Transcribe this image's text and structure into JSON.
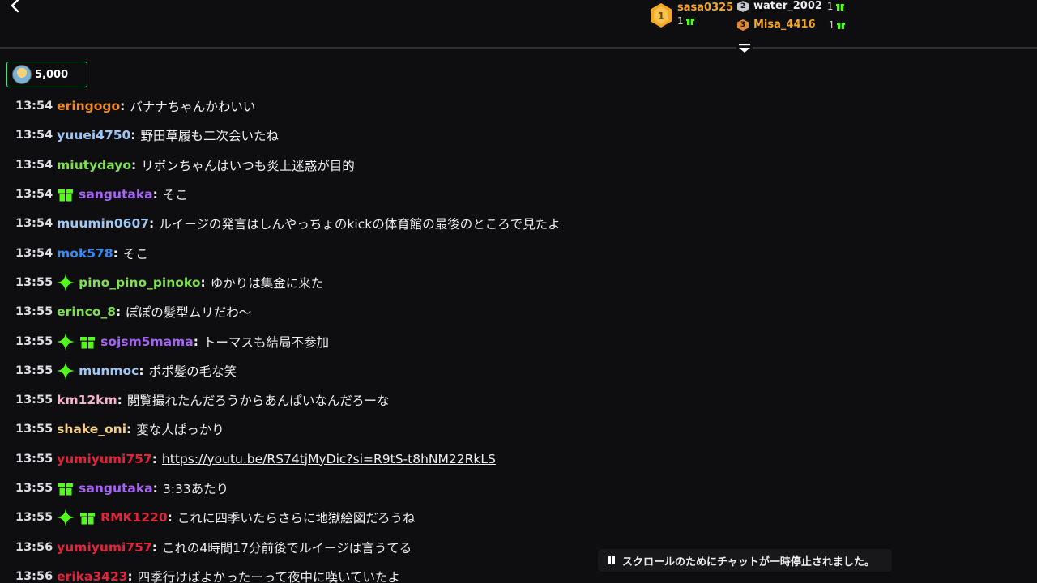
{
  "leaderboard": {
    "first": {
      "rank": "1",
      "name": "sasa0325",
      "count": "1"
    },
    "second": {
      "rank": "2",
      "name": "water_2002",
      "count": "1"
    },
    "third": {
      "rank": "3",
      "name": "Misa_4416",
      "count": "1"
    }
  },
  "sub_badge": {
    "value": "5,000"
  },
  "messages": [
    {
      "time": "13:54",
      "user": "eringogo",
      "text": "バナナちゃんかわいい",
      "color": "#f08a24",
      "badges": []
    },
    {
      "time": "13:54",
      "user": "yuuei4750",
      "text": "野田草履も二次会いたね",
      "color": "#9ec7f5",
      "badges": []
    },
    {
      "time": "13:54",
      "user": "miutydayo",
      "text": "リボンちゃんはいつも炎上迷惑が目的",
      "color": "#7ee051",
      "badges": []
    },
    {
      "time": "13:54",
      "user": "sangutaka",
      "text": "そこ",
      "color": "#a463f2",
      "badges": [
        "gift"
      ]
    },
    {
      "time": "13:54",
      "user": "muumin0607",
      "text": "ルイージの発言はしんやっちょのkickの体育館の最後のところで見たよ",
      "color": "#9ec7f5",
      "badges": []
    },
    {
      "time": "13:54",
      "user": "mok578",
      "text": "そこ",
      "color": "#3a8af0",
      "badges": []
    },
    {
      "time": "13:55",
      "user": "pino_pino_pinoko",
      "text": "ゆかりは集金に来た",
      "color": "#7ee051",
      "badges": [
        "sparkle"
      ]
    },
    {
      "time": "13:55",
      "user": "erinco_8",
      "text": "ぽぽの髪型ムリだわ〜",
      "color": "#7ee051",
      "badges": []
    },
    {
      "time": "13:55",
      "user": "sojsm5mama",
      "text": "トーマスも結局不参加",
      "color": "#a463f2",
      "badges": [
        "sparkle",
        "gift"
      ]
    },
    {
      "time": "13:55",
      "user": "munmoc",
      "text": "ポポ髪の毛な笑",
      "color": "#9ec7f5",
      "badges": [
        "sparkle"
      ]
    },
    {
      "time": "13:55",
      "user": "km12km",
      "text": "閲覧撮れたんだろうからあんぱいなんだろーな",
      "color": "#f5b2c8",
      "badges": []
    },
    {
      "time": "13:55",
      "user": "shake_oni",
      "text": "変な人ぱっかり",
      "color": "#f5d08a",
      "badges": []
    },
    {
      "time": "13:55",
      "user": "yumiyumi757",
      "text": "https://youtu.be/RS74tjMyDic?si=R9tS-t8hNM22RkLS",
      "color": "#e0243c",
      "badges": [],
      "is_link": true
    },
    {
      "time": "13:55",
      "user": "sangutaka",
      "text": "3:33あたり",
      "color": "#a463f2",
      "badges": [
        "gift"
      ]
    },
    {
      "time": "13:55",
      "user": "RMK1220",
      "text": "これに四季いたらさらに地獄絵図だろうね",
      "color": "#e0243c",
      "badges": [
        "sparkle",
        "gift"
      ]
    },
    {
      "time": "13:56",
      "user": "yumiyumi757",
      "text": "これの4時間17分前後でルイージは言うてる",
      "color": "#e0243c",
      "badges": []
    },
    {
      "time": "13:56",
      "user": "erika3423",
      "text": "四季行けばよかったーって夜中に嘆いていたよ",
      "color": "#e0243c",
      "badges": []
    }
  ],
  "paused_notice": "スクロールのためにチャットが一時停止されました。",
  "colors": {
    "accent_green": "#53fc18",
    "gold": "#f5a623",
    "bronze": "#e08a3a"
  }
}
